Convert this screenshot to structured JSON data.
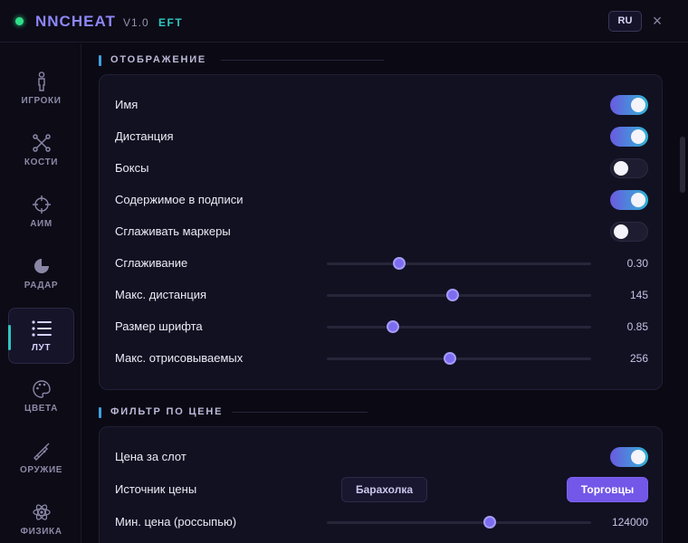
{
  "app": {
    "title": "NNCHEAT",
    "version": "V1.0",
    "game": "EFT",
    "lang": "RU",
    "close_icon": "×"
  },
  "sidebar": {
    "items": [
      {
        "label": "ИГРОКИ",
        "icon": "person-icon",
        "active": false
      },
      {
        "label": "КОСТИ",
        "icon": "bones-icon",
        "active": false
      },
      {
        "label": "АИМ",
        "icon": "crosshair-icon",
        "active": false
      },
      {
        "label": "РАДАР",
        "icon": "radar-icon",
        "active": false
      },
      {
        "label": "ЛУТ",
        "icon": "list-icon",
        "active": true
      },
      {
        "label": "ЦВЕТА",
        "icon": "palette-icon",
        "active": false
      },
      {
        "label": "ОРУЖИЕ",
        "icon": "rifle-icon",
        "active": false
      },
      {
        "label": "ФИЗИКА",
        "icon": "atom-icon",
        "active": false
      }
    ]
  },
  "section_display": {
    "title": "ОТОБРАЖЕНИЕ",
    "rows": [
      {
        "label": "Имя",
        "type": "toggle",
        "on": true
      },
      {
        "label": "Дистанция",
        "type": "toggle",
        "on": true
      },
      {
        "label": "Боксы",
        "type": "toggle",
        "on": false
      },
      {
        "label": "Содержимое в подписи",
        "type": "toggle",
        "on": true
      },
      {
        "label": "Сглаживать маркеры",
        "type": "toggle",
        "on": false
      },
      {
        "label": "Сглаживание",
        "type": "slider",
        "value": "0.30",
        "fraction": 0.275
      },
      {
        "label": "Макс. дистанция",
        "type": "slider",
        "value": "145",
        "fraction": 0.475
      },
      {
        "label": "Размер шрифта",
        "type": "slider",
        "value": "0.85",
        "fraction": 0.25
      },
      {
        "label": "Макс. отрисовываемых",
        "type": "slider",
        "value": "256",
        "fraction": 0.465
      }
    ]
  },
  "section_price": {
    "title": "ФИЛЬТР ПО ЦЕНЕ",
    "rows": [
      {
        "label": "Цена за слот",
        "type": "toggle",
        "on": true
      },
      {
        "label": "Источник цены",
        "type": "buttons",
        "options": [
          {
            "label": "Барахолка",
            "selected": false
          },
          {
            "label": "Торговцы",
            "selected": true
          }
        ]
      },
      {
        "label": "Мин. цена (россыпью)",
        "type": "slider",
        "value": "124000",
        "fraction": 0.615
      }
    ]
  },
  "colors": {
    "accent": "#7257e8",
    "teal": "#2fc7c0",
    "online": "#2fe08a"
  }
}
